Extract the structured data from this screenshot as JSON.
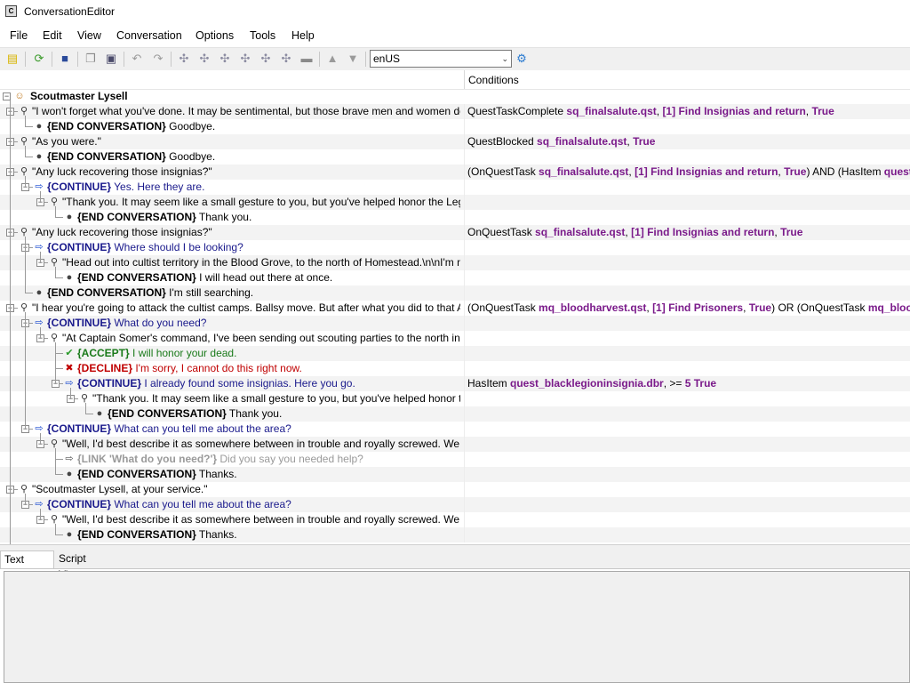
{
  "window": {
    "title": "ConversationEditor"
  },
  "menu": [
    "File",
    "Edit",
    "View",
    "Conversation",
    "Options",
    "Tools",
    "Help"
  ],
  "toolbar": {
    "locale": "enUS",
    "icons": [
      "new-file-icon",
      "refresh-icon",
      "save-icon",
      "copy-icon",
      "paste-icon",
      "undo-icon",
      "redo-icon",
      "add-node-icon",
      "add-child-icon",
      "add-sibling-icon",
      "add-link-icon",
      "add-script-icon",
      "remove-icon",
      "move-up-icon",
      "move-down-icon",
      "settings-gear-icon"
    ]
  },
  "header": {
    "conditions": "Conditions"
  },
  "root": {
    "label": "Scoutmaster Lysell"
  },
  "rows": [
    {
      "text": "\"I won't forget what you've done. It may be sentimental, but those brave men and women deserv...",
      "cond": [
        [
          "QuestTaskComplete ",
          ""
        ],
        [
          "sq_finalsalute.qst",
          "p"
        ],
        [
          ", ",
          ""
        ],
        [
          "[1] Find Insignias and return",
          "p"
        ],
        [
          ", ",
          ""
        ],
        [
          "True",
          "p"
        ]
      ]
    },
    {
      "kw": "{END CONVERSATION}",
      "text": " Goodbye.",
      "cond": []
    },
    {
      "text": "\"As you were.\"",
      "cond": [
        [
          "QuestBlocked ",
          ""
        ],
        [
          "sq_finalsalute.qst",
          "p"
        ],
        [
          ", ",
          ""
        ],
        [
          "True",
          "p"
        ]
      ]
    },
    {
      "kw": "{END CONVERSATION}",
      "text": " Goodbye.",
      "cond": []
    },
    {
      "text": "\"Any luck recovering those insignias?\"",
      "cond": [
        [
          "(OnQuestTask ",
          ""
        ],
        [
          "sq_finalsalute.qst",
          "p"
        ],
        [
          ", ",
          ""
        ],
        [
          "[1] Find Insignias and return",
          "p"
        ],
        [
          ", ",
          ""
        ],
        [
          "True",
          "p"
        ],
        [
          ") AND (HasItem ",
          ""
        ],
        [
          "quest_bla",
          "p"
        ]
      ]
    },
    {
      "kw": "{CONTINUE}",
      "text": " Yes. Here they are.",
      "cond": []
    },
    {
      "text": "\"Thank you. It may seem like a small gesture to you, but you've helped honor the Legion's ...",
      "cond": []
    },
    {
      "kw": "{END CONVERSATION}",
      "text": " Thank you.",
      "cond": []
    },
    {
      "text": "\"Any luck recovering those insignias?\"",
      "cond": [
        [
          "OnQuestTask ",
          ""
        ],
        [
          "sq_finalsalute.qst",
          "p"
        ],
        [
          ", ",
          ""
        ],
        [
          "[1] Find Insignias and return",
          "p"
        ],
        [
          ", ",
          ""
        ],
        [
          "True",
          "p"
        ]
      ]
    },
    {
      "kw": "{CONTINUE}",
      "text": " Where should I be looking?",
      "cond": []
    },
    {
      "text": "\"Head out into cultist territory in the Blood Grove, to the north of Homestead.\\n\\nI'm not h...",
      "cond": []
    },
    {
      "kw": "{END CONVERSATION}",
      "text": " I will head out there at once.",
      "cond": []
    },
    {
      "kw": "{END CONVERSATION}",
      "text": " I'm still searching.",
      "cond": []
    },
    {
      "text": "\"I hear you're going to attack the cultist camps. Ballsy move. But after what you did to that Aetheri...",
      "cond": [
        [
          "(OnQuestTask ",
          ""
        ],
        [
          "mq_bloodharvest.qst",
          "p"
        ],
        [
          ", ",
          ""
        ],
        [
          "[1] Find Prisoners",
          "p"
        ],
        [
          ", ",
          ""
        ],
        [
          "True",
          "p"
        ],
        [
          ") OR (OnQuestTask ",
          ""
        ],
        [
          "mq_bloodhar",
          "p"
        ]
      ]
    },
    {
      "kw": "{CONTINUE}",
      "text": " What do you need?",
      "cond": []
    },
    {
      "text": "\"At Captain Somer's command, I've been sending out scouting parties to the north in order...",
      "cond": []
    },
    {
      "kw": "{ACCEPT}",
      "text": " I will honor your dead.",
      "cond": []
    },
    {
      "kw": "{DECLINE}",
      "text": " I'm sorry, I cannot do this right now.",
      "cond": []
    },
    {
      "kw": "{CONTINUE}",
      "text": " I already found some insignias. Here you go.",
      "cond": [
        [
          "HasItem ",
          ""
        ],
        [
          "quest_blacklegioninsignia.dbr",
          "p"
        ],
        [
          ", >= ",
          ""
        ],
        [
          "5 True",
          "p"
        ]
      ]
    },
    {
      "text": "\"Thank you. It may seem like a small gesture to you, but you've helped honor the L...",
      "cond": []
    },
    {
      "kw": "{END CONVERSATION}",
      "text": " Thank you.",
      "cond": []
    },
    {
      "kw": "{CONTINUE}",
      "text": " What can you tell me about the area?",
      "cond": []
    },
    {
      "text": "\"Well, I'd best describe it as somewhere between in trouble and royally screwed. We have...",
      "cond": []
    },
    {
      "kw": "{LINK 'What do you need?'}",
      "text": " Did you say you needed help?",
      "cond": []
    },
    {
      "kw": "{END CONVERSATION}",
      "text": " Thanks.",
      "cond": []
    },
    {
      "text": "\"Scoutmaster Lysell, at your service.\"",
      "cond": []
    },
    {
      "kw": "{CONTINUE}",
      "text": " What can you tell me about the area?",
      "cond": []
    },
    {
      "text": "\"Well, I'd best describe it as somewhere between in trouble and royally screwed. We have...",
      "cond": []
    },
    {
      "kw": "{END CONVERSATION}",
      "text": " Thanks.",
      "cond": []
    }
  ],
  "tabs": [
    "Text Editor",
    "Script Viewer"
  ],
  "editor": {
    "text": ""
  }
}
